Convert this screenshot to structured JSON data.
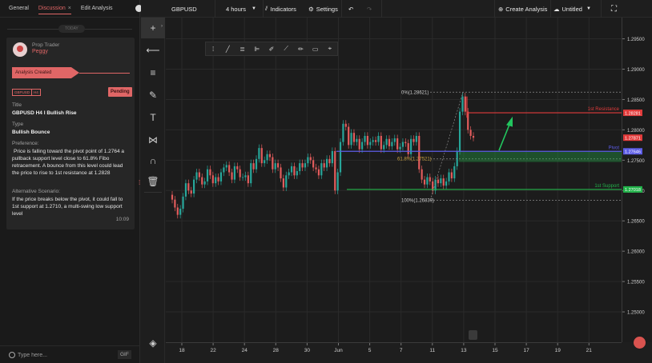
{
  "tabs": [
    {
      "label": "General"
    },
    {
      "label": "Discussion",
      "close": "×"
    },
    {
      "label": "Edit Analysis"
    }
  ],
  "today": "TODAY",
  "card": {
    "author_label": "Prop Trader",
    "author_name": "Peggy",
    "created_label": "Analysis Created",
    "pair_tag": "GBPUSD",
    "tf_tag": "H4",
    "status": "Pending",
    "title_label": "Title",
    "title": "GBPUSD H4 I Bullish Rise",
    "type_label": "Type",
    "type": "Bullish Bounce",
    "preference_label": "Preference:",
    "preference": "Price is falling toward the pivot point of 1.2764 a pullback support level close to 61.8% Fibo retracement. A bounce from this level could lead the price to rise to 1st resistance at 1.2828",
    "alt_label": "Alternative Scenario:",
    "alt": "If the price breaks below the pivot, it could fall to 1st support at 1.2710, a multi-swing low support level",
    "time": "10:09"
  },
  "input": {
    "placeholder": "Type here...",
    "gif": "GIF"
  },
  "topbar": {
    "symbol": "GBPUSD",
    "timeframe": "4 hours",
    "indicators": "Indicators",
    "settings": "Settings",
    "create": "Create Analysis",
    "layout": "Untitled"
  },
  "chart_data": {
    "type": "line",
    "title": "",
    "y_ticks": [
      "1.29500",
      "1.29000",
      "1.28500",
      "1.28000",
      "1.27500",
      "1.27000",
      "1.26500",
      "1.26000",
      "1.25500",
      "1.25000"
    ],
    "x_ticks": [
      "18",
      "22",
      "24",
      "28",
      "30",
      "Jun",
      "5",
      "7",
      "11",
      "13",
      "15",
      "17",
      "19",
      "21"
    ],
    "ylim": [
      1.245,
      1.2985
    ],
    "price_labels": [
      {
        "text": "1.28281",
        "value": 1.28281,
        "color": "#e23b3b"
      },
      {
        "text": "1.27871",
        "value": 1.27871,
        "color": "#e23b3b"
      },
      {
        "text": "1.27646",
        "value": 1.27646,
        "color": "#5c5ce6"
      },
      {
        "text": "1.27018",
        "value": 1.27018,
        "color": "#22b34a"
      }
    ],
    "levels": [
      {
        "name": "1st Resistance",
        "value": 1.28281,
        "color": "#e23b3b"
      },
      {
        "name": "Pivot",
        "value": 1.27646,
        "color": "#5c5ce6"
      },
      {
        "name": "1st Support",
        "value": 1.27018,
        "color": "#22b34a"
      }
    ],
    "fibo": [
      {
        "label": "0%(1.28621)",
        "value": 1.28621
      },
      {
        "label": "61.8%(1.27521)",
        "value": 1.27521
      },
      {
        "label": "100%(1.26839)",
        "value": 1.26839
      }
    ],
    "close_prices": [
      1.2685,
      1.2672,
      1.266,
      1.267,
      1.269,
      1.2712,
      1.27,
      1.2695,
      1.2718,
      1.273,
      1.2722,
      1.271,
      1.2715,
      1.2735,
      1.2725,
      1.2712,
      1.2722,
      1.2715,
      1.273,
      1.2738,
      1.2742,
      1.273,
      1.2718,
      1.274,
      1.2735,
      1.2722,
      1.2722,
      1.2725,
      1.2712,
      1.2745,
      1.2735,
      1.2752,
      1.277,
      1.2745,
      1.275,
      1.276,
      1.2755,
      1.2735,
      1.2745,
      1.2738,
      1.272,
      1.2705,
      1.2725,
      1.273,
      1.274,
      1.2725,
      1.2732,
      1.2745,
      1.2738,
      1.2745,
      1.2755,
      1.275,
      1.2738,
      1.2735,
      1.2725,
      1.2745,
      1.2738,
      1.2752,
      1.2745,
      1.2765,
      1.27,
      1.273,
      1.278,
      1.281,
      1.2805,
      1.2775,
      1.2795,
      1.278,
      1.2785,
      1.2768,
      1.278,
      1.279,
      1.2775,
      1.278,
      1.2783,
      1.278,
      1.279,
      1.2768,
      1.2775,
      1.2785,
      1.2773,
      1.278,
      1.2786,
      1.2768,
      1.2772,
      1.278,
      1.2778,
      1.276,
      1.2785,
      1.278,
      1.279,
      1.2735,
      1.2718,
      1.271,
      1.2722,
      1.2715,
      1.27,
      1.2718,
      1.2712,
      1.272,
      1.2708,
      1.2715,
      1.273,
      1.272,
      1.274,
      1.2765,
      1.283,
      1.2855,
      1.283,
      1.28,
      1.279,
      1.2787
    ]
  },
  "colors": {
    "accent": "#e06666",
    "bull": "#27a69a",
    "bear": "#e25c5c"
  }
}
